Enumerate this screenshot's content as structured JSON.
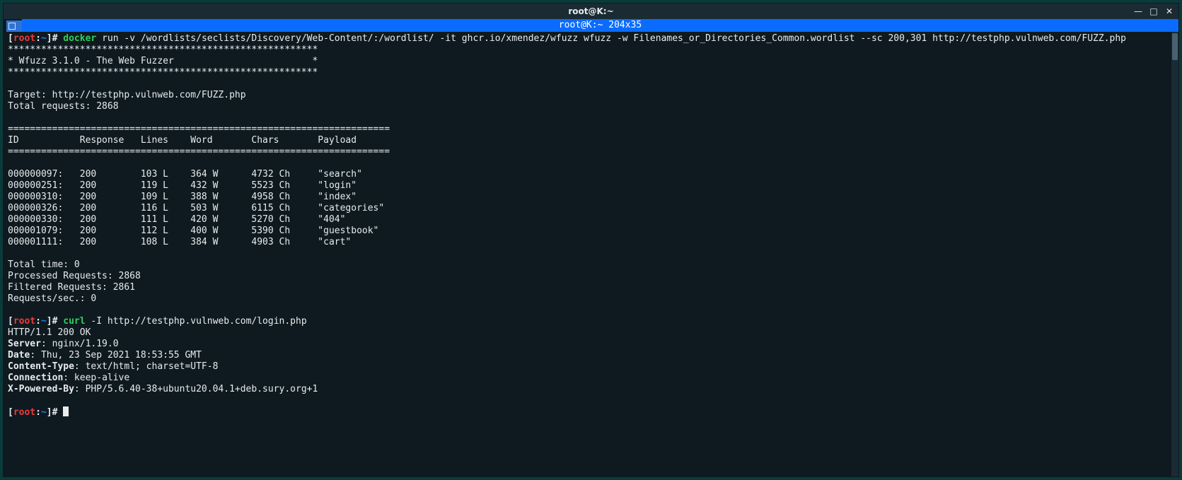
{
  "window": {
    "title": "root@K:~",
    "tab_label": "root@K:~ 204x35"
  },
  "prompt": {
    "open": "[",
    "user": "root",
    "colon": ":",
    "path": "~",
    "close": "]",
    "hash": "#"
  },
  "cmd1": {
    "bin": "docker",
    "args": " run -v /wordlists/seclists/Discovery/Web-Content/:/wordlist/ -it ghcr.io/xmendez/wfuzz wfuzz -w Filenames_or_Directories_Common.wordlist --sc 200,301 http://testphp.vulnweb.com/FUZZ.php"
  },
  "wfuzz": {
    "stars_row": "********************************************************",
    "banner": "* Wfuzz 3.1.0 - The Web Fuzzer                         *",
    "target_line": "Target: http://testphp.vulnweb.com/FUZZ.php",
    "total_req_line": "Total requests: 2868",
    "sep": "=====================================================================",
    "header": "ID           Response   Lines    Word       Chars       Payload",
    "rows": [
      {
        "id": "000000097:",
        "resp": "200",
        "lines": "103 L",
        "word": "364 W",
        "chars": "4732 Ch",
        "payload": "\"search\""
      },
      {
        "id": "000000251:",
        "resp": "200",
        "lines": "119 L",
        "word": "432 W",
        "chars": "5523 Ch",
        "payload": "\"login\""
      },
      {
        "id": "000000310:",
        "resp": "200",
        "lines": "109 L",
        "word": "388 W",
        "chars": "4958 Ch",
        "payload": "\"index\""
      },
      {
        "id": "000000326:",
        "resp": "200",
        "lines": "116 L",
        "word": "503 W",
        "chars": "6115 Ch",
        "payload": "\"categories\""
      },
      {
        "id": "000000330:",
        "resp": "200",
        "lines": "111 L",
        "word": "420 W",
        "chars": "5270 Ch",
        "payload": "\"404\""
      },
      {
        "id": "000001079:",
        "resp": "200",
        "lines": "112 L",
        "word": "400 W",
        "chars": "5390 Ch",
        "payload": "\"guestbook\""
      },
      {
        "id": "000001111:",
        "resp": "200",
        "lines": "108 L",
        "word": "384 W",
        "chars": "4903 Ch",
        "payload": "\"cart\""
      }
    ],
    "totaltime": "Total time: 0",
    "processed": "Processed Requests: 2868",
    "filtered": "Filtered Requests: 2861",
    "rps": "Requests/sec.: 0"
  },
  "cmd2": {
    "bin": "curl",
    "args": " -I http://testphp.vulnweb.com/login.php"
  },
  "curl": {
    "status": "HTTP/1.1 200 OK",
    "headers": [
      {
        "k": "Server",
        "v": ": nginx/1.19.0"
      },
      {
        "k": "Date",
        "v": ": Thu, 23 Sep 2021 18:53:55 GMT"
      },
      {
        "k": "Content-Type",
        "v": ": text/html; charset=UTF-8"
      },
      {
        "k": "Connection",
        "v": ": keep-alive"
      },
      {
        "k": "X-Powered-By",
        "v": ": PHP/5.6.40-38+ubuntu20.04.1+deb.sury.org+1"
      }
    ]
  },
  "controls": {
    "min": "—",
    "max": "□",
    "close": "✕"
  }
}
